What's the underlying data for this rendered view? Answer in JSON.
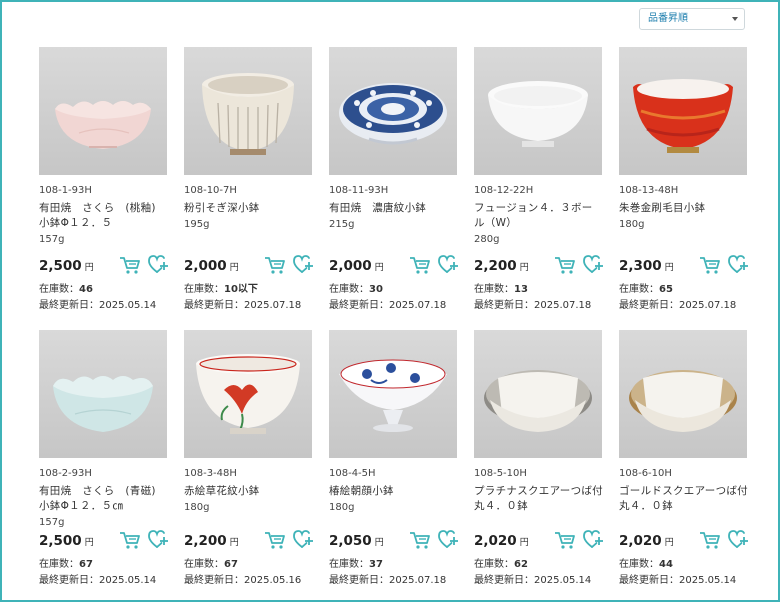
{
  "sort": {
    "selected": "品番昇順"
  },
  "labels": {
    "stock": "在庫数：",
    "updated": "最終更新日：",
    "yen": "円"
  },
  "colors": {
    "accent": "#3fb3b8",
    "border": "#3fb3b8",
    "sort_text": "#1f7fae"
  },
  "products": [
    {
      "code": "108-1-93H",
      "name": "有田焼　さくら　(桃釉) 小鉢Φ１２．５",
      "weight": "157g",
      "price": "2,500",
      "stock": "46",
      "updated": "2025.05.14"
    },
    {
      "code": "108-10-7H",
      "name": "粉引そぎ深小鉢",
      "weight": "195g",
      "price": "2,000",
      "stock": "10以下",
      "updated": "2025.07.18"
    },
    {
      "code": "108-11-93H",
      "name": "有田焼　濃唐紋小鉢",
      "weight": "215g",
      "price": "2,000",
      "stock": "30",
      "updated": "2025.07.18"
    },
    {
      "code": "108-12-22H",
      "name": "フュージョン４．３ボール（W）",
      "weight": "280g",
      "price": "2,200",
      "stock": "13",
      "updated": "2025.07.18"
    },
    {
      "code": "108-13-48H",
      "name": "朱巻金刷毛目小鉢",
      "weight": "180g",
      "price": "2,300",
      "stock": "65",
      "updated": "2025.07.18"
    },
    {
      "code": "108-2-93H",
      "name": "有田焼　さくら　(青磁) 小鉢Φ１２．５㎝",
      "weight": "157g",
      "price": "2,500",
      "stock": "67",
      "updated": "2025.05.14"
    },
    {
      "code": "108-3-48H",
      "name": "赤絵草花紋小鉢",
      "weight": "180g",
      "price": "2,200",
      "stock": "67",
      "updated": "2025.05.16"
    },
    {
      "code": "108-4-5H",
      "name": "椿絵朝顔小鉢",
      "weight": "180g",
      "price": "2,050",
      "stock": "37",
      "updated": "2025.07.18"
    },
    {
      "code": "108-5-10H",
      "name": "プラチナスクエアーつば付　丸４．０鉢",
      "weight": "",
      "price": "2,020",
      "stock": "62",
      "updated": "2025.05.14"
    },
    {
      "code": "108-6-10H",
      "name": "ゴールドスクエアーつば付　丸４．０鉢",
      "weight": "",
      "price": "2,020",
      "stock": "44",
      "updated": "2025.05.14"
    }
  ]
}
